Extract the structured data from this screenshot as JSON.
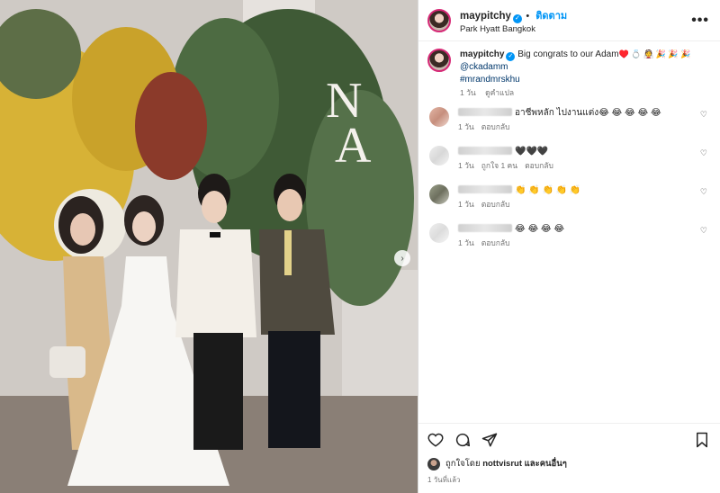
{
  "post": {
    "username": "maypitchy",
    "follow_label": "ติดตาม",
    "location": "Park Hyatt Bangkok",
    "caption_text": "Big congrats to our Adam",
    "caption_emoji": "♥️ 💍 👰 🎉 🎉 🎉",
    "mention": "@ckadamm",
    "hashtag": "#mrandmrskhu",
    "caption_time": "1 วัน",
    "translate_label": "ดูคำแปล",
    "monogram": "NA"
  },
  "comments": [
    {
      "text": "อาชีพหลัก ไปงานแต่ง😂 😂 😂 😂 😂",
      "time": "1 วัน",
      "likes": "",
      "reply": "ตอบกลับ"
    },
    {
      "text": "🖤🖤🖤",
      "time": "1 วัน",
      "likes": "ถูกใจ 1 คน",
      "reply": "ตอบกลับ"
    },
    {
      "text": "👏 👏 👏 👏 👏",
      "time": "1 วัน",
      "likes": "",
      "reply": "ตอบกลับ"
    },
    {
      "text": "😂 😂 😂 😂",
      "time": "1 วัน",
      "likes": "",
      "reply": "ตอบกลับ"
    }
  ],
  "likes": {
    "prefix": "ถูกใจโดย",
    "user": "nottvisrut",
    "suffix": "และคนอื่นๆ"
  },
  "posted": "1 วันที่แล้ว",
  "icons": [
    "heart-icon",
    "comment-icon",
    "share-icon",
    "bookmark-icon",
    "more-icon",
    "verified-icon",
    "chevron-right-icon"
  ],
  "colors": {
    "accent": "#0095f6",
    "link": "#00376b",
    "muted": "#737373"
  }
}
